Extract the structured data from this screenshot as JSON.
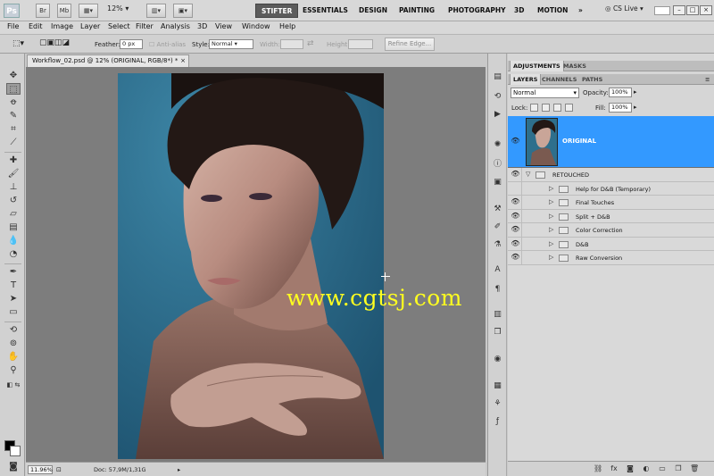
{
  "app": {
    "logo": "Ps",
    "bridge": "Br",
    "minibridge": "Mb",
    "zoom": "12%",
    "workspaces": [
      "STIFTER",
      "ESSENTIALS",
      "DESIGN",
      "PAINTING",
      "PHOTOGRAPHY",
      "3D",
      "MOTION"
    ],
    "more": "»",
    "cs_live": "CS Live",
    "win_min": "–",
    "win_max": "□",
    "win_close": "×"
  },
  "menu": [
    "File",
    "Edit",
    "Image",
    "Layer",
    "Select",
    "Filter",
    "Analysis",
    "3D",
    "View",
    "Window",
    "Help"
  ],
  "options": {
    "feather_label": "Feather:",
    "feather_value": "0 px",
    "antialias_label": "Anti-alias",
    "style_label": "Style:",
    "style_value": "Normal",
    "width_label": "Width:",
    "height_label": "Height:",
    "refine_edge": "Refine Edge..."
  },
  "document": {
    "tab_title": "Workflow_02.psd @ 12% (ORIGINAL, RGB/8*) *",
    "close": "×",
    "watermark": "www.cgtsj.com",
    "status_zoom": "11.96%",
    "status_doc": "Doc: 57,9M/1,31G"
  },
  "panels": {
    "top_tabs": [
      "ADJUSTMENTS",
      "MASKS"
    ],
    "layer_tabs": [
      "LAYERS",
      "CHANNELS",
      "PATHS"
    ],
    "blend_mode": "Normal",
    "opacity_label": "Opacity:",
    "opacity_value": "100%",
    "lock_label": "Lock:",
    "fill_label": "Fill:",
    "fill_value": "100%"
  },
  "layers": {
    "original": "ORIGINAL",
    "group": "RETOUCHED",
    "children": [
      "Help for D&B (Temporary)",
      "Final Touches",
      "Split + D&B",
      "Color Correction",
      "D&B",
      "Raw Conversion"
    ]
  },
  "colors": {
    "selected_layer": "#3399ff",
    "background": "#2e6f8c",
    "watermark": "#ffff20"
  }
}
